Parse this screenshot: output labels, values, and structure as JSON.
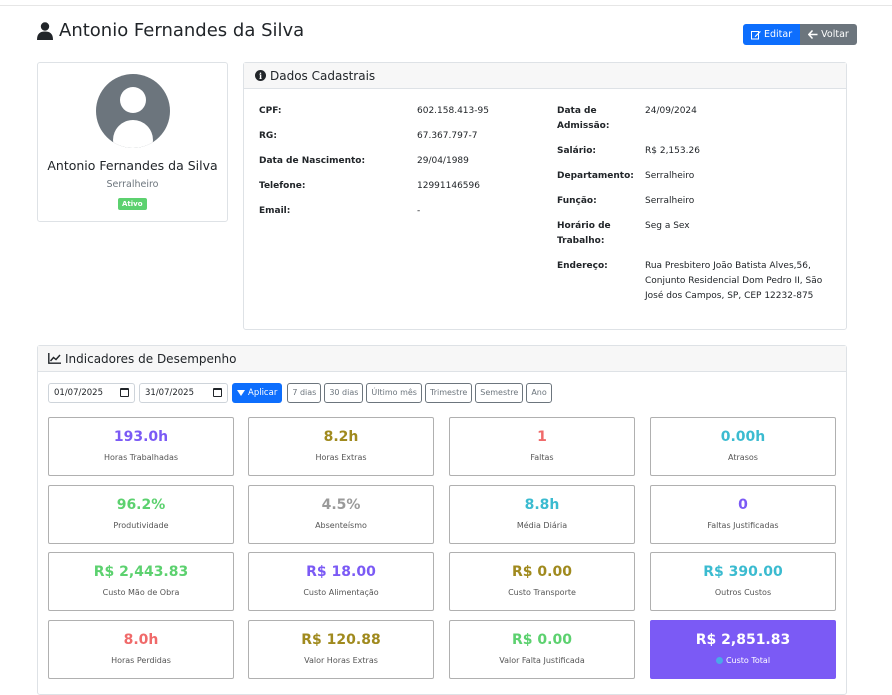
{
  "header": {
    "title": "Antonio Fernandes da Silva",
    "edit_label": "Editar",
    "back_label": "Voltar"
  },
  "profile": {
    "name": "Antonio Fernandes da Silva",
    "role": "Serralheiro",
    "status": "Ativo"
  },
  "info": {
    "title": "Dados Cadastrais",
    "left": [
      {
        "label": "CPF:",
        "value": "602.158.413-95"
      },
      {
        "label": "RG:",
        "value": "67.367.797-7"
      },
      {
        "label": "Data de Nascimento:",
        "value": "29/04/1989"
      },
      {
        "label": "Telefone:",
        "value": "12991146596"
      },
      {
        "label": "Email:",
        "value": "-"
      }
    ],
    "right": [
      {
        "label_l1": "Data de",
        "label_l2": "Admissão:",
        "value": "24/09/2024"
      },
      {
        "label_l1": "Salário:",
        "value": "R$ 2,153.26"
      },
      {
        "label_l1": "Departamento:",
        "value": "Serralheiro"
      },
      {
        "label_l1": "Função:",
        "value": "Serralheiro"
      },
      {
        "label_l1": "Horário de",
        "label_l2": "Trabalho:",
        "value": "Seg a Sex"
      },
      {
        "label_l1": "Endereço:",
        "value_l1": "Rua Presbitero João Batista Alves,56,",
        "value_l2": "Conjunto Residencial Dom Pedro II, São",
        "value_l3": "José dos Campos, SP, CEP 12232-875"
      }
    ]
  },
  "kpi": {
    "title": "Indicadores de Desempenho",
    "date_start": "01/07/2025",
    "date_end": "31/07/2025",
    "apply_label": "Aplicar",
    "ranges": [
      "7 dias",
      "30 dias",
      "Último mês",
      "Trimestre",
      "Semestre",
      "Ano"
    ],
    "metrics": [
      {
        "value": "193.0h",
        "label": "Horas Trabalhadas",
        "color": "#7b5af5"
      },
      {
        "value": "8.2h",
        "label": "Horas Extras",
        "color": "#a08a1e"
      },
      {
        "value": "1",
        "label": "Faltas",
        "color": "#f06a6a"
      },
      {
        "value": "0.00h",
        "label": "Atrasos",
        "color": "#3bbbd0"
      },
      {
        "value": "96.2%",
        "label": "Produtividade",
        "color": "#5cd16f"
      },
      {
        "value": "4.5%",
        "label": "Absenteísmo",
        "color": "#9a9a9a"
      },
      {
        "value": "8.8h",
        "label": "Média Diária",
        "color": "#3bbbd0"
      },
      {
        "value": "0",
        "label": "Faltas Justificadas",
        "color": "#7b5af5"
      },
      {
        "value": "R$ 2,443.83",
        "label": "Custo Mão de Obra",
        "color": "#5cd16f"
      },
      {
        "value": "R$ 18.00",
        "label": "Custo Alimentação",
        "color": "#7b5af5"
      },
      {
        "value": "R$ 0.00",
        "label": "Custo Transporte",
        "color": "#a08a1e"
      },
      {
        "value": "R$ 390.00",
        "label": "Outros Custos",
        "color": "#3bbbd0"
      },
      {
        "value": "8.0h",
        "label": "Horas Perdidas",
        "color": "#f06a6a"
      },
      {
        "value": "R$ 120.88",
        "label": "Valor Horas Extras",
        "color": "#a08a1e"
      },
      {
        "value": "R$ 0.00",
        "label": "Valor Falta Justificada",
        "color": "#5cd16f"
      },
      {
        "value": "R$ 2,851.83",
        "label": "Custo Total",
        "color": "#ffffff"
      }
    ]
  }
}
